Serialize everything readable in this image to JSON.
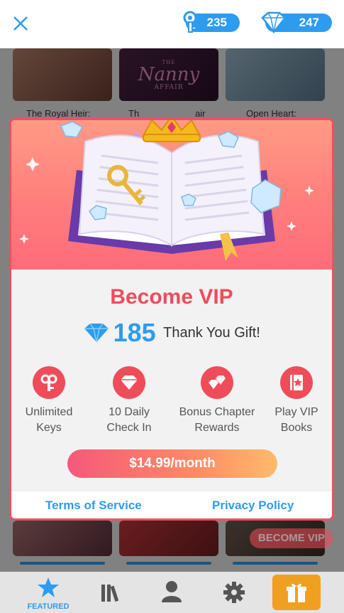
{
  "topbar": {
    "keys": {
      "icon": "key-icon",
      "value": "235"
    },
    "gems": {
      "icon": "diamond-icon",
      "value": "247"
    }
  },
  "background": {
    "titles": [
      "The Royal Heir:",
      "Th",
      "air",
      "Open Heart:"
    ],
    "cover_text": {
      "top": "THE",
      "main": "Nanny",
      "bottom": "AFFAIR"
    },
    "badge": "BECOME VIP"
  },
  "modal": {
    "title": "Become VIP",
    "gift_amount": "185",
    "gift_text": "Thank You Gift!",
    "perks": [
      {
        "icon": "key-icon",
        "line1": "Unlimited",
        "line2": "Keys"
      },
      {
        "icon": "diamond-icon",
        "line1": "10 Daily",
        "line2": "Check In"
      },
      {
        "icon": "diamonds-icon",
        "line1": "Bonus Chapter",
        "line2": "Rewards"
      },
      {
        "icon": "vip-book-icon",
        "line1": "Play VIP",
        "line2": "Books"
      }
    ],
    "cta": "$14.99/month",
    "terms": "Terms of Service",
    "privacy": "Privacy Policy"
  },
  "nav": {
    "featured_label": "FEATURED",
    "items": [
      "star-icon",
      "library-icon",
      "profile-icon",
      "gear-icon",
      "gift-icon"
    ]
  },
  "colors": {
    "accent": "#2d9bf0",
    "vip_red": "#ef4c5a",
    "cta_start": "#f5587a",
    "cta_end": "#ffbb6b"
  }
}
